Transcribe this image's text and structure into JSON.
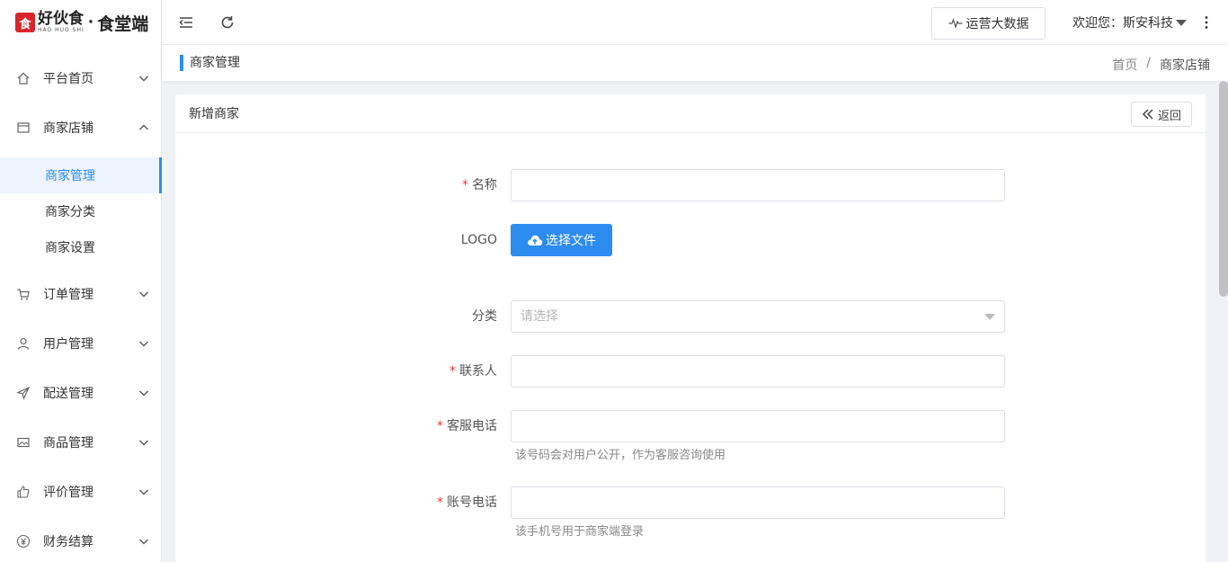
{
  "logo": {
    "mark": "食",
    "brand": "好伙食",
    "pinyin": "HAO HUO SHI",
    "dot": "·",
    "sub": "食堂端"
  },
  "header": {
    "bigdata_label": "运营大数据",
    "welcome_label": "欢迎您：斯安科技"
  },
  "sidebar": {
    "items": [
      {
        "label": "平台首页",
        "icon": "home-icon"
      },
      {
        "label": "商家店铺",
        "icon": "shop-icon"
      },
      {
        "label": "订单管理",
        "icon": "cart-icon"
      },
      {
        "label": "用户管理",
        "icon": "user-icon"
      },
      {
        "label": "配送管理",
        "icon": "send-icon"
      },
      {
        "label": "商品管理",
        "icon": "image-icon"
      },
      {
        "label": "评价管理",
        "icon": "thumb-icon"
      },
      {
        "label": "财务结算",
        "icon": "yen-icon"
      }
    ],
    "subitems": [
      {
        "label": "商家管理",
        "active": true
      },
      {
        "label": "商家分类",
        "active": false
      },
      {
        "label": "商家设置",
        "active": false
      }
    ]
  },
  "pagebar": {
    "title": "商家管理",
    "breadcrumb": [
      "首页",
      "/",
      "商家店铺"
    ]
  },
  "card": {
    "title": "新增商家",
    "back_label": "返回"
  },
  "form": {
    "name_label": "名称",
    "logo_label": "LOGO",
    "upload_label": "选择文件",
    "category_label": "分类",
    "category_placeholder": "请选择",
    "contact_label": "联系人",
    "service_phone_label": "客服电话",
    "service_phone_help": "该号码会对用户公开，作为客服咨询使用",
    "account_phone_label": "账号电话",
    "account_phone_help": "该手机号用于商家端登录",
    "required_mark": "*"
  },
  "colors": {
    "accent": "#2d8cf0",
    "required": "#e4393c",
    "logo_red": "#d9262c"
  }
}
